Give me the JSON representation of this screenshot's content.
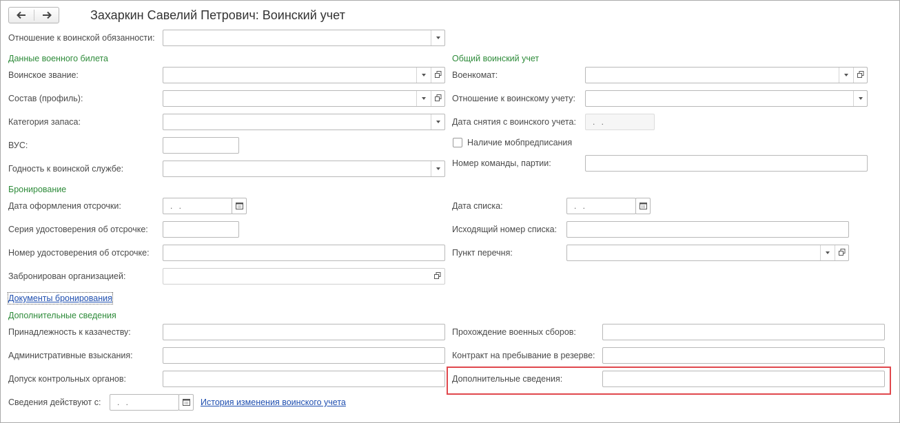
{
  "window": {
    "title": "Захаркин Савелий Петрович: Воинский учет"
  },
  "icons": {
    "back": "arrow-left-icon",
    "forward": "arrow-right-icon",
    "dropdown": "triangle-down-icon",
    "open": "open-window-icon",
    "calendar": "calendar-icon"
  },
  "colors": {
    "section_green": "#2e8b3a",
    "link_blue": "#1f4fb0",
    "highlight_red": "#e0474c"
  },
  "top": {
    "attitude_label": "Отношение к воинской обязанности:",
    "attitude_value": ""
  },
  "ticket": {
    "section": "Данные военного билета",
    "rank_label": "Воинское звание:",
    "rank_value": "",
    "profile_label": "Состав (профиль):",
    "profile_value": "",
    "category_label": "Категория запаса:",
    "category_value": "",
    "vus_label": "ВУС:",
    "vus_value": "",
    "fitness_label": "Годность к воинской службе:",
    "fitness_value": ""
  },
  "general": {
    "section": "Общий воинский учет",
    "commissariat_label": "Военкомат:",
    "commissariat_value": "",
    "attitude_label": "Отношение к воинскому учету:",
    "attitude_value": "",
    "removal_date_label": "Дата снятия с воинского учета:",
    "removal_date_value": " .  .",
    "mob_label": "Наличие мобпредписания",
    "mob_checked": false,
    "team_label": "Номер команды, партии:",
    "team_value": ""
  },
  "reservation": {
    "section": "Бронирование",
    "deferral_date_label": "Дата оформления отсрочки:",
    "deferral_date_value": " .  .",
    "cert_series_label": "Серия удостоверения об отсрочке:",
    "cert_series_value": "",
    "cert_number_label": "Номер удостоверения об отсрочке:",
    "cert_number_value": "",
    "reserved_by_label": "Забронирован организацией:",
    "reserved_by_value": "",
    "docs_link": "Документы бронирования",
    "list_date_label": "Дата списка:",
    "list_date_value": " .  .",
    "outgoing_number_label": "Исходящий номер списка:",
    "outgoing_number_value": "",
    "list_item_label": "Пункт перечня:",
    "list_item_value": ""
  },
  "additional": {
    "section": "Дополнительные сведения",
    "cossack_label": "Принадлежность к казачеству:",
    "cossack_value": "",
    "penalties_label": "Административные взыскания:",
    "penalties_value": "",
    "admission_label": "Допуск контрольных органов:",
    "admission_value": "",
    "training_label": "Прохождение военных сборов:",
    "training_value": "",
    "contract_label": "Контракт на пребывание в резерве:",
    "contract_value": "",
    "extra_label": "Дополнительные сведения:",
    "extra_value": ""
  },
  "footer": {
    "effective_label": "Сведения действуют с:",
    "effective_value": " .  .",
    "history_link": "История изменения воинского учета"
  }
}
